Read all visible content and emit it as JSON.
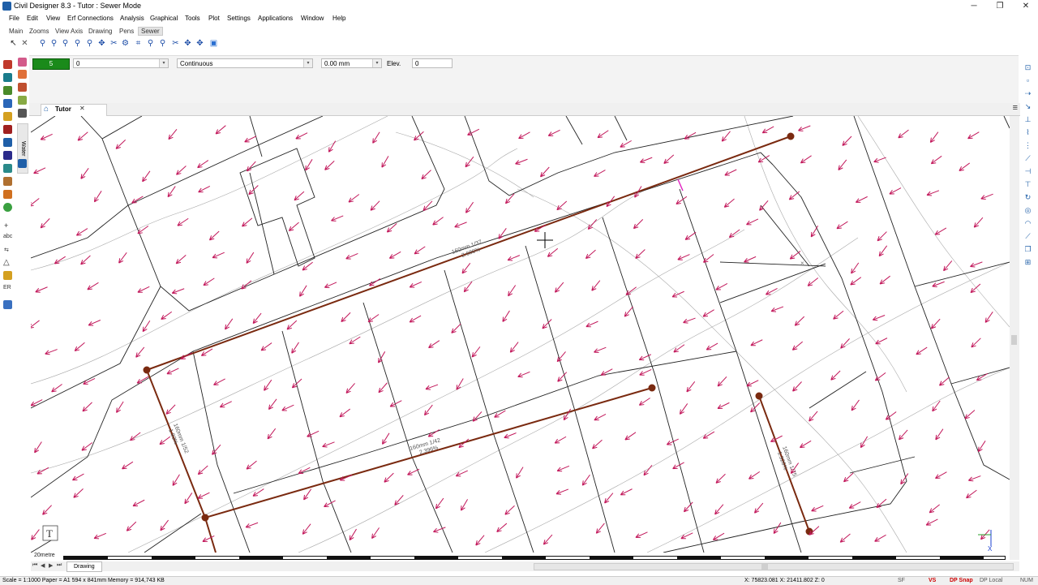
{
  "window": {
    "title": "Civil Designer 8.3 - Tutor : Sewer Mode",
    "controls": [
      "─",
      "❐",
      "✕"
    ]
  },
  "menu": {
    "items": [
      "File",
      "Edit",
      "View",
      "Erf Connections",
      "Analysis",
      "Graphical",
      "Tools",
      "Plot",
      "Settings",
      "Applications",
      "Window",
      "Help"
    ]
  },
  "ribbon_tabs": {
    "items": [
      "Main",
      "Zooms",
      "View Axis",
      "Drawing",
      "Pens",
      "Sewer"
    ],
    "active": "Sewer"
  },
  "properties": {
    "color_value": "5",
    "layer_value": "0",
    "linetype": "Continuous",
    "lineweight": "0.00 mm",
    "elev_label": "Elev.",
    "elev_value": "0"
  },
  "side_panel": {
    "label": "Water"
  },
  "document_tab": {
    "label": "Tutor"
  },
  "drawing": {
    "pipe_labels": [
      {
        "line1": "160mm 1/37",
        "line2": "2.686%"
      },
      {
        "line1": "160mm 1/42",
        "line2": "2.396%"
      },
      {
        "line1": "160mm 1/52",
        "line2": "1.93%"
      },
      {
        "line1": "160mm 1/75",
        "line2": "1.326%"
      }
    ],
    "north_symbol": "T",
    "scale_label": "20metre"
  },
  "sheet_tabs": {
    "items": [
      "Drawing"
    ]
  },
  "status": {
    "left": "Scale = 1:1000  Paper = A1 594 x 841mm  Memory = 914,743 KB",
    "coords": "X: 75823.081 X: 21411.802 Z: 0",
    "flags": [
      "SF",
      "VS",
      "DP Snap",
      "DP Local",
      "NUM"
    ]
  },
  "colors": {
    "pipe": "#7a2a10",
    "arrow": "#c2185b",
    "boundary": "#222222",
    "contour": "#9a9a9a",
    "color_swatch": "#1a8a1a"
  }
}
